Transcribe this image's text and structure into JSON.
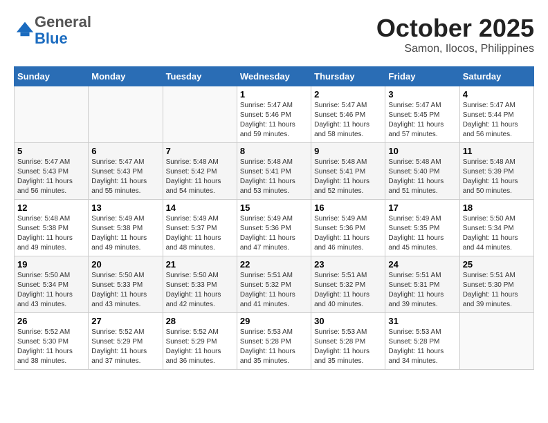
{
  "logo": {
    "general": "General",
    "blue": "Blue"
  },
  "header": {
    "month": "October 2025",
    "location": "Samon, Ilocos, Philippines"
  },
  "weekdays": [
    "Sunday",
    "Monday",
    "Tuesday",
    "Wednesday",
    "Thursday",
    "Friday",
    "Saturday"
  ],
  "weeks": [
    [
      {
        "day": "",
        "sunrise": "",
        "sunset": "",
        "daylight": ""
      },
      {
        "day": "",
        "sunrise": "",
        "sunset": "",
        "daylight": ""
      },
      {
        "day": "",
        "sunrise": "",
        "sunset": "",
        "daylight": ""
      },
      {
        "day": "1",
        "sunrise": "Sunrise: 5:47 AM",
        "sunset": "Sunset: 5:46 PM",
        "daylight": "Daylight: 11 hours and 59 minutes."
      },
      {
        "day": "2",
        "sunrise": "Sunrise: 5:47 AM",
        "sunset": "Sunset: 5:46 PM",
        "daylight": "Daylight: 11 hours and 58 minutes."
      },
      {
        "day": "3",
        "sunrise": "Sunrise: 5:47 AM",
        "sunset": "Sunset: 5:45 PM",
        "daylight": "Daylight: 11 hours and 57 minutes."
      },
      {
        "day": "4",
        "sunrise": "Sunrise: 5:47 AM",
        "sunset": "Sunset: 5:44 PM",
        "daylight": "Daylight: 11 hours and 56 minutes."
      }
    ],
    [
      {
        "day": "5",
        "sunrise": "Sunrise: 5:47 AM",
        "sunset": "Sunset: 5:43 PM",
        "daylight": "Daylight: 11 hours and 56 minutes."
      },
      {
        "day": "6",
        "sunrise": "Sunrise: 5:47 AM",
        "sunset": "Sunset: 5:43 PM",
        "daylight": "Daylight: 11 hours and 55 minutes."
      },
      {
        "day": "7",
        "sunrise": "Sunrise: 5:48 AM",
        "sunset": "Sunset: 5:42 PM",
        "daylight": "Daylight: 11 hours and 54 minutes."
      },
      {
        "day": "8",
        "sunrise": "Sunrise: 5:48 AM",
        "sunset": "Sunset: 5:41 PM",
        "daylight": "Daylight: 11 hours and 53 minutes."
      },
      {
        "day": "9",
        "sunrise": "Sunrise: 5:48 AM",
        "sunset": "Sunset: 5:41 PM",
        "daylight": "Daylight: 11 hours and 52 minutes."
      },
      {
        "day": "10",
        "sunrise": "Sunrise: 5:48 AM",
        "sunset": "Sunset: 5:40 PM",
        "daylight": "Daylight: 11 hours and 51 minutes."
      },
      {
        "day": "11",
        "sunrise": "Sunrise: 5:48 AM",
        "sunset": "Sunset: 5:39 PM",
        "daylight": "Daylight: 11 hours and 50 minutes."
      }
    ],
    [
      {
        "day": "12",
        "sunrise": "Sunrise: 5:48 AM",
        "sunset": "Sunset: 5:38 PM",
        "daylight": "Daylight: 11 hours and 49 minutes."
      },
      {
        "day": "13",
        "sunrise": "Sunrise: 5:49 AM",
        "sunset": "Sunset: 5:38 PM",
        "daylight": "Daylight: 11 hours and 49 minutes."
      },
      {
        "day": "14",
        "sunrise": "Sunrise: 5:49 AM",
        "sunset": "Sunset: 5:37 PM",
        "daylight": "Daylight: 11 hours and 48 minutes."
      },
      {
        "day": "15",
        "sunrise": "Sunrise: 5:49 AM",
        "sunset": "Sunset: 5:36 PM",
        "daylight": "Daylight: 11 hours and 47 minutes."
      },
      {
        "day": "16",
        "sunrise": "Sunrise: 5:49 AM",
        "sunset": "Sunset: 5:36 PM",
        "daylight": "Daylight: 11 hours and 46 minutes."
      },
      {
        "day": "17",
        "sunrise": "Sunrise: 5:49 AM",
        "sunset": "Sunset: 5:35 PM",
        "daylight": "Daylight: 11 hours and 45 minutes."
      },
      {
        "day": "18",
        "sunrise": "Sunrise: 5:50 AM",
        "sunset": "Sunset: 5:34 PM",
        "daylight": "Daylight: 11 hours and 44 minutes."
      }
    ],
    [
      {
        "day": "19",
        "sunrise": "Sunrise: 5:50 AM",
        "sunset": "Sunset: 5:34 PM",
        "daylight": "Daylight: 11 hours and 43 minutes."
      },
      {
        "day": "20",
        "sunrise": "Sunrise: 5:50 AM",
        "sunset": "Sunset: 5:33 PM",
        "daylight": "Daylight: 11 hours and 43 minutes."
      },
      {
        "day": "21",
        "sunrise": "Sunrise: 5:50 AM",
        "sunset": "Sunset: 5:33 PM",
        "daylight": "Daylight: 11 hours and 42 minutes."
      },
      {
        "day": "22",
        "sunrise": "Sunrise: 5:51 AM",
        "sunset": "Sunset: 5:32 PM",
        "daylight": "Daylight: 11 hours and 41 minutes."
      },
      {
        "day": "23",
        "sunrise": "Sunrise: 5:51 AM",
        "sunset": "Sunset: 5:32 PM",
        "daylight": "Daylight: 11 hours and 40 minutes."
      },
      {
        "day": "24",
        "sunrise": "Sunrise: 5:51 AM",
        "sunset": "Sunset: 5:31 PM",
        "daylight": "Daylight: 11 hours and 39 minutes."
      },
      {
        "day": "25",
        "sunrise": "Sunrise: 5:51 AM",
        "sunset": "Sunset: 5:30 PM",
        "daylight": "Daylight: 11 hours and 39 minutes."
      }
    ],
    [
      {
        "day": "26",
        "sunrise": "Sunrise: 5:52 AM",
        "sunset": "Sunset: 5:30 PM",
        "daylight": "Daylight: 11 hours and 38 minutes."
      },
      {
        "day": "27",
        "sunrise": "Sunrise: 5:52 AM",
        "sunset": "Sunset: 5:29 PM",
        "daylight": "Daylight: 11 hours and 37 minutes."
      },
      {
        "day": "28",
        "sunrise": "Sunrise: 5:52 AM",
        "sunset": "Sunset: 5:29 PM",
        "daylight": "Daylight: 11 hours and 36 minutes."
      },
      {
        "day": "29",
        "sunrise": "Sunrise: 5:53 AM",
        "sunset": "Sunset: 5:28 PM",
        "daylight": "Daylight: 11 hours and 35 minutes."
      },
      {
        "day": "30",
        "sunrise": "Sunrise: 5:53 AM",
        "sunset": "Sunset: 5:28 PM",
        "daylight": "Daylight: 11 hours and 35 minutes."
      },
      {
        "day": "31",
        "sunrise": "Sunrise: 5:53 AM",
        "sunset": "Sunset: 5:28 PM",
        "daylight": "Daylight: 11 hours and 34 minutes."
      },
      {
        "day": "",
        "sunrise": "",
        "sunset": "",
        "daylight": ""
      }
    ]
  ]
}
